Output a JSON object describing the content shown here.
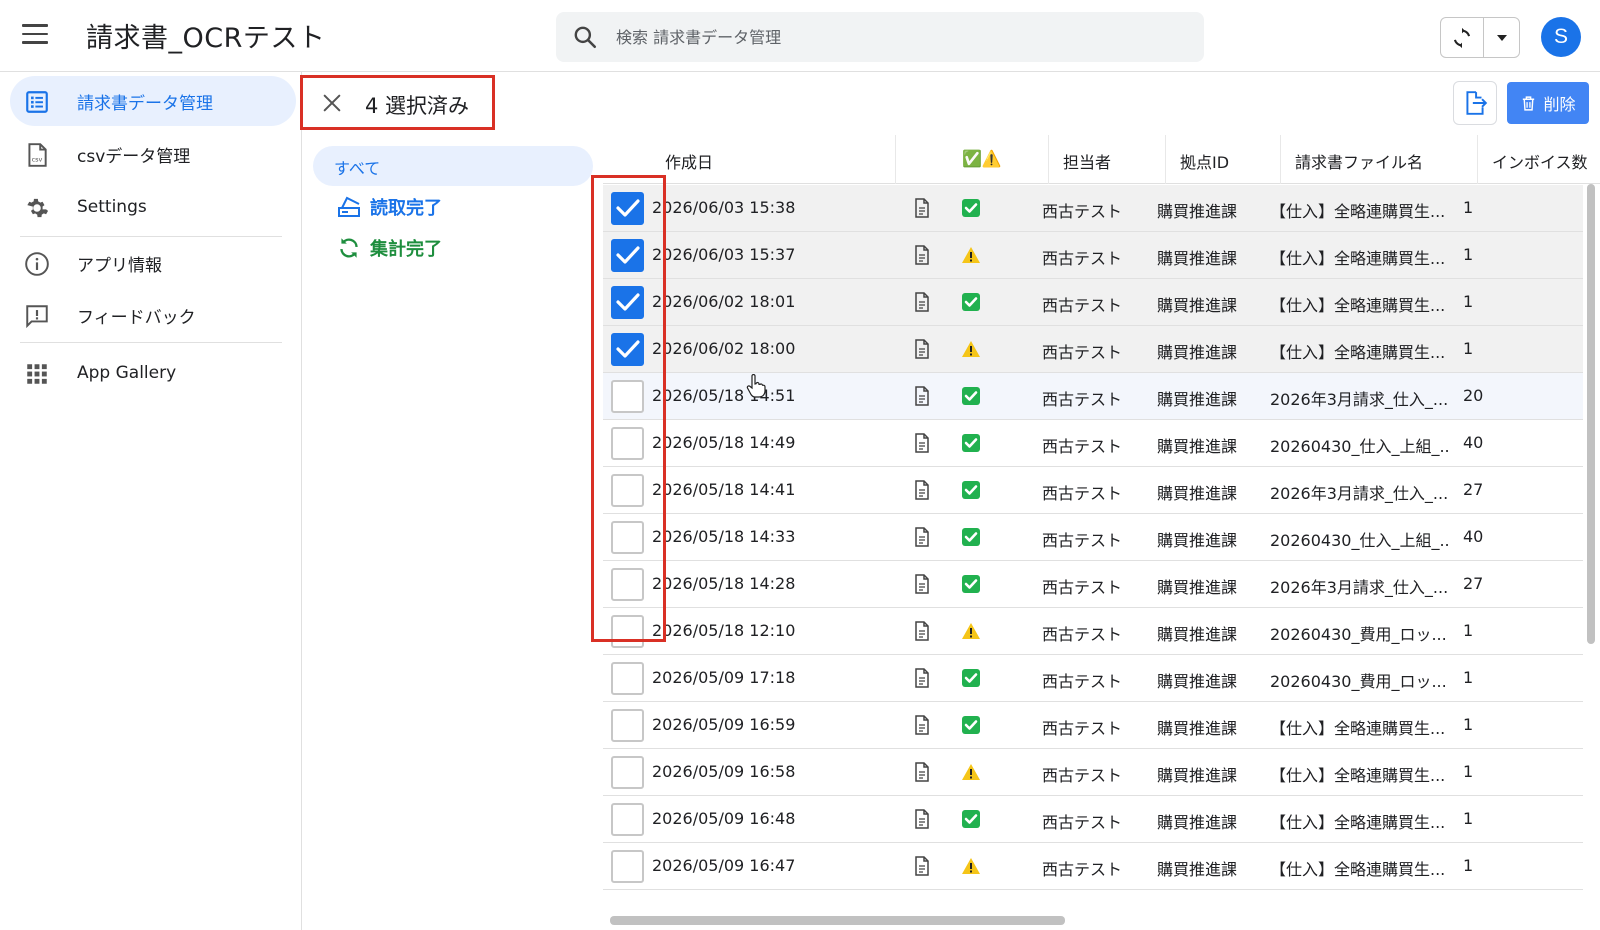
{
  "app": {
    "title": "請求書_OCRテスト",
    "search_placeholder": "検索 請求書データ管理",
    "avatar_initial": "S",
    "accent_color": "#1a73e8"
  },
  "sidebar": {
    "items": [
      {
        "label": "請求書データ管理",
        "icon": "list-document-icon",
        "active": true
      },
      {
        "label": "csvデータ管理",
        "icon": "csv-file-icon",
        "active": false
      },
      {
        "label": "Settings",
        "icon": "gear-icon",
        "active": false
      },
      {
        "label": "アプリ情報",
        "icon": "info-icon",
        "active": false
      },
      {
        "label": "フィードバック",
        "icon": "feedback-icon",
        "active": false
      },
      {
        "label": "App Gallery",
        "icon": "grid-icon",
        "active": false
      }
    ]
  },
  "selection": {
    "count_label": "4 選択済み",
    "delete_label": "削除"
  },
  "filters": {
    "all": "すべて",
    "read_complete": "読取完了",
    "aggregate_complete": "集計完了",
    "read_color": "#1a73e8",
    "aggregate_color": "#1e8e3e"
  },
  "table": {
    "headers": {
      "created": "作成日",
      "status": "✅⚠️",
      "owner": "担当者",
      "site_id": "拠点ID",
      "file_name": "請求書ファイル名",
      "invoice": "インボイス数"
    },
    "rows": [
      {
        "date": "2026/06/03 15:38",
        "status": "ok",
        "owner": "西古テスト",
        "site": "購買推進課",
        "file": "【仕入】全略連購買生...",
        "invoice": "1",
        "checked": true
      },
      {
        "date": "2026/06/03 15:37",
        "status": "warn",
        "owner": "西古テスト",
        "site": "購買推進課",
        "file": "【仕入】全略連購買生...",
        "invoice": "1",
        "checked": true
      },
      {
        "date": "2026/06/02 18:01",
        "status": "ok",
        "owner": "西古テスト",
        "site": "購買推進課",
        "file": "【仕入】全略連購買生...",
        "invoice": "1",
        "checked": true
      },
      {
        "date": "2026/06/02 18:00",
        "status": "warn",
        "owner": "西古テスト",
        "site": "購買推進課",
        "file": "【仕入】全略連購買生...",
        "invoice": "1",
        "checked": true
      },
      {
        "date": "2026/05/18 14:51",
        "status": "ok",
        "owner": "西古テスト",
        "site": "購買推進課",
        "file": "2026年3月請求_仕入_...",
        "invoice": "20",
        "checked": false
      },
      {
        "date": "2026/05/18 14:49",
        "status": "ok",
        "owner": "西古テスト",
        "site": "購買推進課",
        "file": "20260430_仕入_上組_...",
        "invoice": "40",
        "checked": false
      },
      {
        "date": "2026/05/18 14:41",
        "status": "ok",
        "owner": "西古テスト",
        "site": "購買推進課",
        "file": "2026年3月請求_仕入_...",
        "invoice": "27",
        "checked": false
      },
      {
        "date": "2026/05/18 14:33",
        "status": "ok",
        "owner": "西古テスト",
        "site": "購買推進課",
        "file": "20260430_仕入_上組_...",
        "invoice": "40",
        "checked": false
      },
      {
        "date": "2026/05/18 14:28",
        "status": "ok",
        "owner": "西古テスト",
        "site": "購買推進課",
        "file": "2026年3月請求_仕入_...",
        "invoice": "27",
        "checked": false
      },
      {
        "date": "2026/05/18 12:10",
        "status": "warn",
        "owner": "西古テスト",
        "site": "購買推進課",
        "file": "20260430_費用_ロッ...",
        "invoice": "1",
        "checked": false
      },
      {
        "date": "2026/05/09 17:18",
        "status": "ok",
        "owner": "西古テスト",
        "site": "購買推進課",
        "file": "20260430_費用_ロッ...",
        "invoice": "1",
        "checked": false
      },
      {
        "date": "2026/05/09 16:59",
        "status": "ok",
        "owner": "西古テスト",
        "site": "購買推進課",
        "file": "【仕入】全略連購買生...",
        "invoice": "1",
        "checked": false
      },
      {
        "date": "2026/05/09 16:58",
        "status": "warn",
        "owner": "西古テスト",
        "site": "購買推進課",
        "file": "【仕入】全略連購買生...",
        "invoice": "1",
        "checked": false
      },
      {
        "date": "2026/05/09 16:48",
        "status": "ok",
        "owner": "西古テスト",
        "site": "購買推進課",
        "file": "【仕入】全略連購買生...",
        "invoice": "1",
        "checked": false
      },
      {
        "date": "2026/05/09 16:47",
        "status": "warn",
        "owner": "西古テスト",
        "site": "購買推進課",
        "file": "【仕入】全略連購買生...",
        "invoice": "1",
        "checked": false
      }
    ]
  }
}
